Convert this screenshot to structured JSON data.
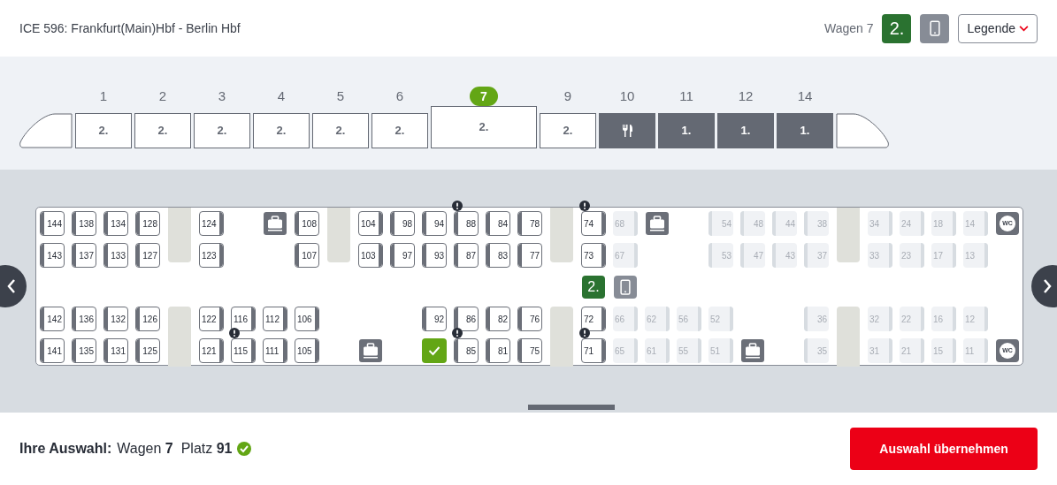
{
  "header": {
    "title": "ICE 596: Frankfurt(Main)Hbf - Berlin Hbf",
    "wagon": "Wagen 7",
    "class_badge": "2.",
    "legend_button": "Legende"
  },
  "coaches": [
    {
      "number": "1",
      "label": "2.",
      "kind": "second",
      "selected": false
    },
    {
      "number": "2",
      "label": "2.",
      "kind": "second",
      "selected": false
    },
    {
      "number": "3",
      "label": "2.",
      "kind": "second",
      "selected": false
    },
    {
      "number": "4",
      "label": "2.",
      "kind": "second",
      "selected": false
    },
    {
      "number": "5",
      "label": "2.",
      "kind": "second",
      "selected": false
    },
    {
      "number": "6",
      "label": "2.",
      "kind": "second",
      "selected": false
    },
    {
      "number": "7",
      "label": "2.",
      "kind": "second",
      "selected": true
    },
    {
      "number": "9",
      "label": "2.",
      "kind": "second",
      "selected": false
    },
    {
      "number": "10",
      "kind": "restaurant",
      "selected": false
    },
    {
      "number": "11",
      "label": "1.",
      "kind": "first",
      "selected": false
    },
    {
      "number": "12",
      "label": "1.",
      "kind": "first",
      "selected": false
    },
    {
      "number": "14",
      "label": "1.",
      "kind": "first",
      "selected": false
    }
  ],
  "seat_map": {
    "class_badge": "2.",
    "wc_labels": [
      "WC",
      "WC"
    ],
    "rows": [
      [
        {
          "number": "144",
          "available": true,
          "selected": false,
          "backrest_left": true,
          "warning": false
        },
        {
          "number": "138",
          "available": true,
          "selected": false,
          "backrest_left": true,
          "warning": false
        },
        {
          "number": "134",
          "available": true,
          "selected": false,
          "backrest_left": true,
          "warning": false
        },
        {
          "number": "128",
          "available": true,
          "selected": false,
          "backrest_left": true,
          "warning": false
        },
        {
          "number": "124",
          "available": true,
          "selected": false,
          "backrest_left": false,
          "warning": false
        },
        {
          "number": "108",
          "available": true,
          "selected": false,
          "backrest_left": true,
          "warning": false
        },
        {
          "number": "104",
          "available": true,
          "selected": false,
          "backrest_left": false,
          "warning": false
        },
        {
          "number": "98",
          "available": true,
          "selected": false,
          "backrest_left": true,
          "warning": false
        },
        {
          "number": "94",
          "available": true,
          "selected": false,
          "backrest_left": true,
          "warning": false
        },
        {
          "number": "88",
          "available": true,
          "selected": false,
          "backrest_left": true,
          "warning": true
        },
        {
          "number": "84",
          "available": true,
          "selected": false,
          "backrest_left": true,
          "warning": false
        },
        {
          "number": "78",
          "available": true,
          "selected": false,
          "backrest_left": true,
          "warning": false
        },
        {
          "number": "74",
          "available": true,
          "selected": false,
          "backrest_left": false,
          "warning": true
        },
        {
          "number": "68",
          "available": false,
          "selected": false,
          "backrest_left": false,
          "warning": false
        },
        {
          "number": "54",
          "available": false,
          "selected": false,
          "backrest_left": true,
          "warning": false
        },
        {
          "number": "48",
          "available": false,
          "selected": false,
          "backrest_left": true,
          "warning": false
        },
        {
          "number": "44",
          "available": false,
          "selected": false,
          "backrest_left": true,
          "warning": false
        },
        {
          "number": "38",
          "available": false,
          "selected": false,
          "backrest_left": true,
          "warning": false
        },
        {
          "number": "34",
          "available": false,
          "selected": false,
          "backrest_left": false,
          "warning": false
        },
        {
          "number": "24",
          "available": false,
          "selected": false,
          "backrest_left": false,
          "warning": false
        },
        {
          "number": "18",
          "available": false,
          "selected": false,
          "backrest_left": false,
          "warning": false
        },
        {
          "number": "14",
          "available": false,
          "selected": false,
          "backrest_left": false,
          "warning": false
        }
      ],
      [
        {
          "number": "143",
          "available": true,
          "selected": false,
          "backrest_left": true,
          "warning": false
        },
        {
          "number": "137",
          "available": true,
          "selected": false,
          "backrest_left": true,
          "warning": false
        },
        {
          "number": "133",
          "available": true,
          "selected": false,
          "backrest_left": true,
          "warning": false
        },
        {
          "number": "127",
          "available": true,
          "selected": false,
          "backrest_left": true,
          "warning": false
        },
        {
          "number": "123",
          "available": true,
          "selected": false,
          "backrest_left": false,
          "warning": false
        },
        {
          "number": "107",
          "available": true,
          "selected": false,
          "backrest_left": true,
          "warning": false
        },
        {
          "number": "103",
          "available": true,
          "selected": false,
          "backrest_left": false,
          "warning": false
        },
        {
          "number": "97",
          "available": true,
          "selected": false,
          "backrest_left": true,
          "warning": false
        },
        {
          "number": "93",
          "available": true,
          "selected": false,
          "backrest_left": true,
          "warning": false
        },
        {
          "number": "87",
          "available": true,
          "selected": false,
          "backrest_left": true,
          "warning": false
        },
        {
          "number": "83",
          "available": true,
          "selected": false,
          "backrest_left": true,
          "warning": false
        },
        {
          "number": "77",
          "available": true,
          "selected": false,
          "backrest_left": true,
          "warning": false
        },
        {
          "number": "73",
          "available": true,
          "selected": false,
          "backrest_left": false,
          "warning": false
        },
        {
          "number": "67",
          "available": false,
          "selected": false,
          "backrest_left": false,
          "warning": false
        },
        {
          "number": "53",
          "available": false,
          "selected": false,
          "backrest_left": true,
          "warning": false
        },
        {
          "number": "47",
          "available": false,
          "selected": false,
          "backrest_left": true,
          "warning": false
        },
        {
          "number": "43",
          "available": false,
          "selected": false,
          "backrest_left": true,
          "warning": false
        },
        {
          "number": "37",
          "available": false,
          "selected": false,
          "backrest_left": true,
          "warning": false
        },
        {
          "number": "33",
          "available": false,
          "selected": false,
          "backrest_left": false,
          "warning": false
        },
        {
          "number": "23",
          "available": false,
          "selected": false,
          "backrest_left": false,
          "warning": false
        },
        {
          "number": "17",
          "available": false,
          "selected": false,
          "backrest_left": false,
          "warning": false
        },
        {
          "number": "13",
          "available": false,
          "selected": false,
          "backrest_left": false,
          "warning": false
        }
      ],
      [
        {
          "number": "142",
          "available": true,
          "selected": false,
          "backrest_left": true,
          "warning": false
        },
        {
          "number": "136",
          "available": true,
          "selected": false,
          "backrest_left": true,
          "warning": false
        },
        {
          "number": "132",
          "available": true,
          "selected": false,
          "backrest_left": true,
          "warning": false
        },
        {
          "number": "126",
          "available": true,
          "selected": false,
          "backrest_left": true,
          "warning": false
        },
        {
          "number": "122",
          "available": true,
          "selected": false,
          "backrest_left": false,
          "warning": false
        },
        {
          "number": "116",
          "available": true,
          "selected": false,
          "backrest_left": false,
          "warning": false
        },
        {
          "number": "112",
          "available": true,
          "selected": false,
          "backrest_left": false,
          "warning": false
        },
        {
          "number": "106",
          "available": true,
          "selected": false,
          "backrest_left": false,
          "warning": false
        },
        {
          "number": "92",
          "available": true,
          "selected": false,
          "backrest_left": true,
          "warning": false
        },
        {
          "number": "86",
          "available": true,
          "selected": false,
          "backrest_left": true,
          "warning": false
        },
        {
          "number": "82",
          "available": true,
          "selected": false,
          "backrest_left": true,
          "warning": false
        },
        {
          "number": "76",
          "available": true,
          "selected": false,
          "backrest_left": true,
          "warning": false
        },
        {
          "number": "72",
          "available": true,
          "selected": false,
          "backrest_left": false,
          "warning": false
        },
        {
          "number": "66",
          "available": false,
          "selected": false,
          "backrest_left": false,
          "warning": false
        },
        {
          "number": "62",
          "available": false,
          "selected": false,
          "backrest_left": false,
          "warning": false
        },
        {
          "number": "56",
          "available": false,
          "selected": false,
          "backrest_left": false,
          "warning": false
        },
        {
          "number": "52",
          "available": false,
          "selected": false,
          "backrest_left": false,
          "warning": false
        },
        {
          "number": "36",
          "available": false,
          "selected": false,
          "backrest_left": true,
          "warning": false
        },
        {
          "number": "32",
          "available": false,
          "selected": false,
          "backrest_left": false,
          "warning": false
        },
        {
          "number": "22",
          "available": false,
          "selected": false,
          "backrest_left": false,
          "warning": false
        },
        {
          "number": "16",
          "available": false,
          "selected": false,
          "backrest_left": false,
          "warning": false
        },
        {
          "number": "12",
          "available": false,
          "selected": false,
          "backrest_left": false,
          "warning": false
        }
      ],
      [
        {
          "number": "141",
          "available": true,
          "selected": false,
          "backrest_left": true,
          "warning": false
        },
        {
          "number": "135",
          "available": true,
          "selected": false,
          "backrest_left": true,
          "warning": false
        },
        {
          "number": "131",
          "available": true,
          "selected": false,
          "backrest_left": true,
          "warning": false
        },
        {
          "number": "125",
          "available": true,
          "selected": false,
          "backrest_left": true,
          "warning": false
        },
        {
          "number": "121",
          "available": true,
          "selected": false,
          "backrest_left": false,
          "warning": false
        },
        {
          "number": "115",
          "available": true,
          "selected": false,
          "backrest_left": false,
          "warning": true
        },
        {
          "number": "111",
          "available": true,
          "selected": false,
          "backrest_left": false,
          "warning": false
        },
        {
          "number": "105",
          "available": true,
          "selected": false,
          "backrest_left": false,
          "warning": false
        },
        {
          "available": true,
          "selected": true,
          "warning": false
        },
        {
          "number": "85",
          "available": true,
          "selected": false,
          "backrest_left": true,
          "warning": true
        },
        {
          "number": "81",
          "available": true,
          "selected": false,
          "backrest_left": true,
          "warning": false
        },
        {
          "number": "75",
          "available": true,
          "selected": false,
          "backrest_left": true,
          "warning": false
        },
        {
          "number": "71",
          "available": true,
          "selected": false,
          "backrest_left": false,
          "warning": true
        },
        {
          "number": "65",
          "available": false,
          "selected": false,
          "backrest_left": false,
          "warning": false
        },
        {
          "number": "61",
          "available": false,
          "selected": false,
          "backrest_left": false,
          "warning": false
        },
        {
          "number": "55",
          "available": false,
          "selected": false,
          "backrest_left": false,
          "warning": false
        },
        {
          "number": "51",
          "available": false,
          "selected": false,
          "backrest_left": false,
          "warning": false
        },
        {
          "number": "35",
          "available": false,
          "selected": false,
          "backrest_left": true,
          "warning": false
        },
        {
          "number": "31",
          "available": false,
          "selected": false,
          "backrest_left": false,
          "warning": false
        },
        {
          "number": "21",
          "available": false,
          "selected": false,
          "backrest_left": false,
          "warning": false
        },
        {
          "number": "15",
          "available": false,
          "selected": false,
          "backrest_left": false,
          "warning": false
        },
        {
          "number": "11",
          "available": false,
          "selected": false,
          "backrest_left": false,
          "warning": false
        }
      ]
    ]
  },
  "footer": {
    "label": "Ihre Auswahl:",
    "selection": "Wagen **7**  Platz **91**",
    "confirm_button": "Auswahl übernehmen"
  }
}
